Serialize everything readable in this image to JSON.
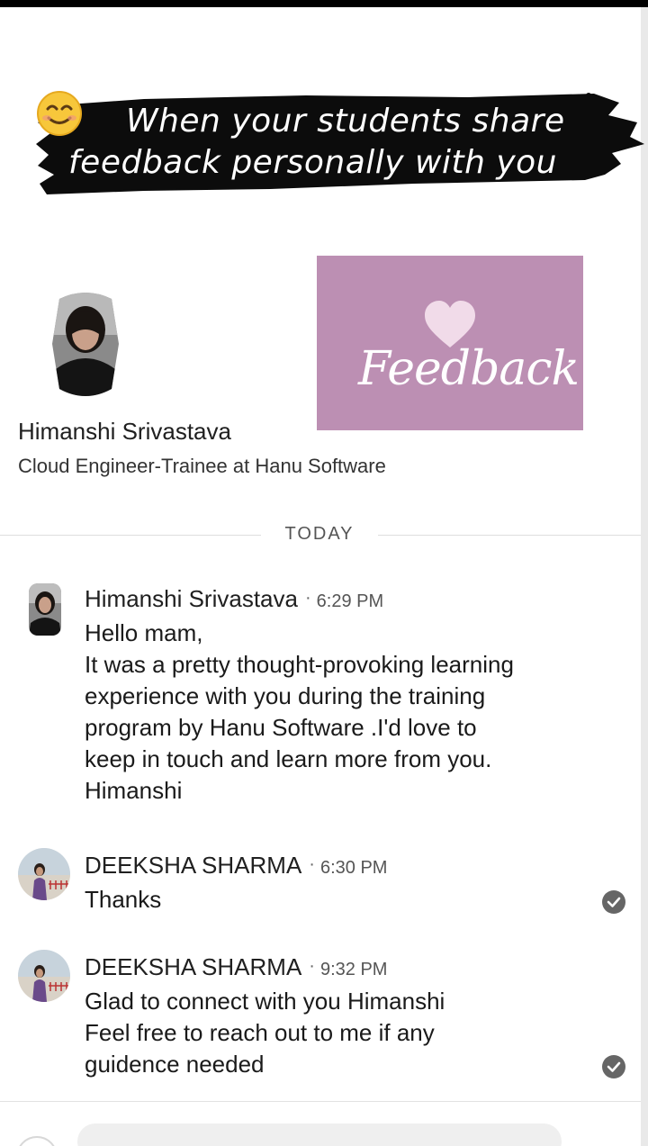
{
  "banner": {
    "line1": "When your students share",
    "line2": "feedback personally with you"
  },
  "profile": {
    "name": "Himanshi Srivastava",
    "headline": "Cloud Engineer-Trainee at Hanu Software"
  },
  "feedback_card": {
    "text": "Feedback",
    "color": "#bc8fb3"
  },
  "divider_label": "TODAY",
  "messages": [
    {
      "sender": "Himanshi Srivastava",
      "separator": "·",
      "time": "6:29 PM",
      "lines": [
        "Hello mam,",
        "It was a pretty thought-provoking learning",
        "experience with you during the training",
        "program by Hanu Software .I'd love to",
        "keep in touch and learn more from you.",
        "Himanshi"
      ]
    },
    {
      "sender": "DEEKSHA SHARMA",
      "separator": "·",
      "time": "6:30 PM",
      "lines": [
        "Thanks"
      ],
      "read_icon": "check-circle-icon"
    },
    {
      "sender": "DEEKSHA SHARMA",
      "separator": "·",
      "time": "9:32 PM",
      "lines": [
        "Glad to connect with you Himanshi",
        "Feel free to reach out to me if any",
        "guidence needed"
      ],
      "read_icon": "check-circle-icon"
    }
  ]
}
